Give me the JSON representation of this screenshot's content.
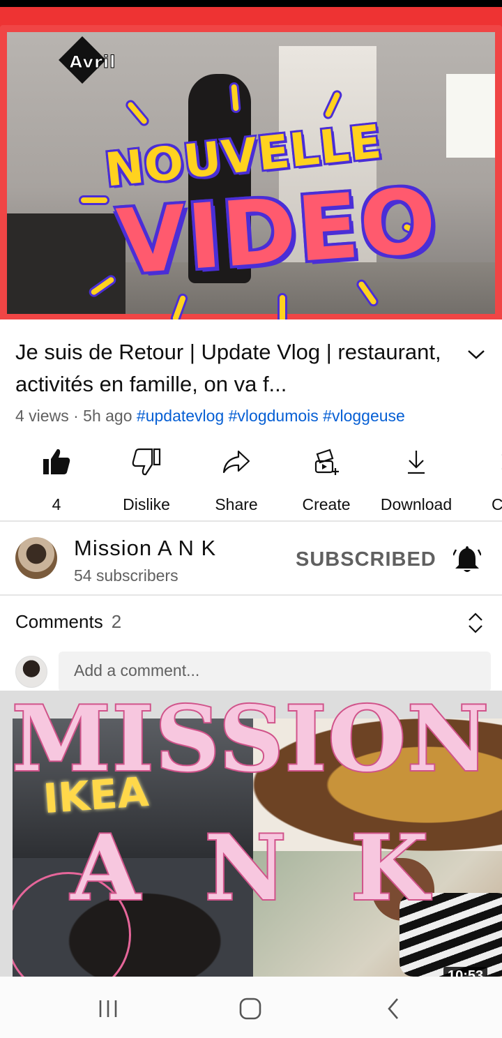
{
  "video": {
    "watermark": "Avril",
    "overlay_line1": "NOUVELLE",
    "overlay_line2": "VIDEO",
    "title": "Je suis de Retour | Update Vlog | restaurant, activités en famille, on va f...",
    "views": "4 views",
    "age": "5h ago",
    "hashtags": [
      "#updatevlog",
      "#vlogdumois",
      "#vloggeuse"
    ]
  },
  "actions": [
    {
      "icon": "like-icon",
      "label": "4"
    },
    {
      "icon": "dislike-icon",
      "label": "Dislike"
    },
    {
      "icon": "share-icon",
      "label": "Share"
    },
    {
      "icon": "create-icon",
      "label": "Create"
    },
    {
      "icon": "download-icon",
      "label": "Download"
    },
    {
      "icon": "clip-icon",
      "label": "C"
    }
  ],
  "channel": {
    "name": "Mission A N K",
    "subscribers": "54 subscribers",
    "subscribe_label": "SUBSCRIBED"
  },
  "comments": {
    "label": "Comments",
    "count": "2",
    "placeholder": "Add a comment..."
  },
  "promo": {
    "line1": "MISSION",
    "line2": "A N K",
    "ikea_text": "IKEA",
    "duration": "10:53"
  },
  "colors": {
    "accent_red": "#f04545",
    "hashtag_blue": "#065fd4",
    "promo_pink": "#f7c7df",
    "promo_stroke": "#d0538a"
  },
  "navbar": {
    "recents": "recents-icon",
    "home": "home-icon",
    "back": "back-icon"
  }
}
